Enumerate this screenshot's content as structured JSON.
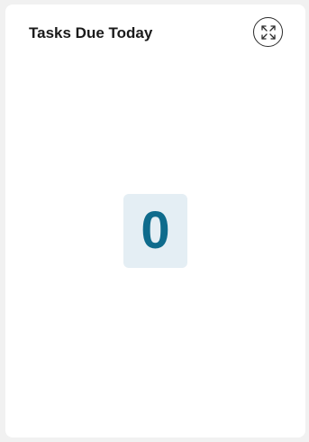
{
  "widget": {
    "title": "Tasks Due Today",
    "count": "0",
    "expand_icon": "expand-arrows-icon"
  },
  "colors": {
    "page_background": "#f1f1f1",
    "card_background": "#ffffff",
    "title_text": "#1a1a1a",
    "count_text": "#0e6b8c",
    "count_background": "#e4eef4"
  }
}
